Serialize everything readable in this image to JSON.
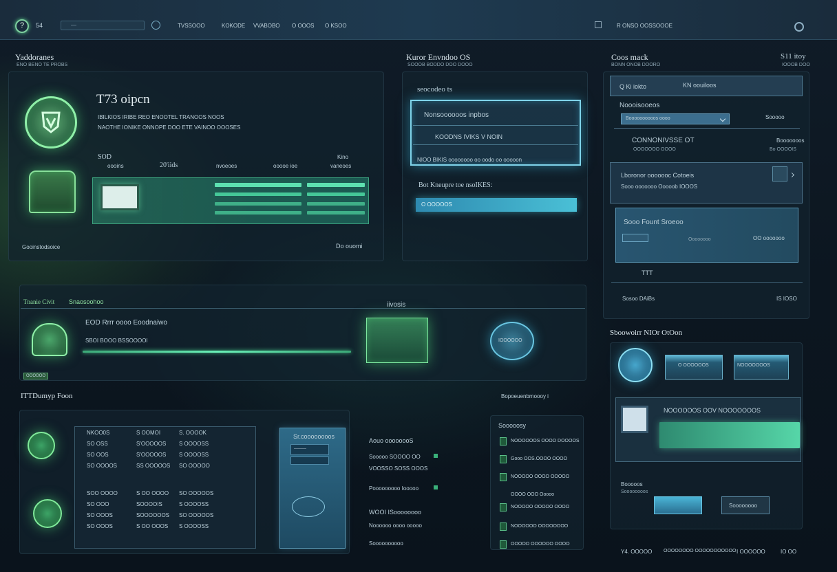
{
  "topbar": {
    "help_glyph": "?",
    "num": "54",
    "search_text": "—",
    "nav1": "TVSSOOO",
    "nav2": "KOKODE",
    "nav3": "VVABOBO",
    "nav4": "O OOOS",
    "nav5": "O KSOO",
    "right_label": "R ONSO OOSSOOOE"
  },
  "panel_a": {
    "title": "Yaddoranes",
    "subtitle": "ENO BENO TE PROBS",
    "big": "T73 oipcn",
    "line1": "IBILKIOS IRIBE REO ENOOTEL TRANOOS NOOS",
    "line2": "NAOTHE IONIKE ONNOPE DOO ETE VAINOO OOOSES",
    "stat1_label": "SOD",
    "stat1": "oooins",
    "stat2": "20'iids",
    "stat3": "nvoeoes",
    "stat4": "ooooe ioe",
    "stat5a": "Kino",
    "stat5b": "vaneoes",
    "footer_left": "Gooinstodsoice",
    "footer_right": "Do ouomi"
  },
  "panel_b": {
    "title": "Kuror Envndoo  OS",
    "subtitle": "SOOOB BODDO DOO DOOO",
    "heading": "seocodeo  ts",
    "box_title": "Nonsoooooos inpbos",
    "box_item": "KOODNS  IVIKS V NOIN",
    "box_footer": "NIOO BIKIS  oooooooo oo oodo oo ooooon",
    "label2": "Bot Kneupre toe nsoIKES:",
    "bar_text": "O OOOOOS"
  },
  "panel_c": {
    "title": "Coos mack",
    "subtitle": "BONN ONOB DOORO",
    "right": "S11 itoy",
    "right_sub": "IOOOB DOO",
    "row1a": "Q Ki iokto",
    "row1b": "KN oouiloos",
    "heading": "Noooisooeos",
    "select_text": "Boooooooooos oooo",
    "select_right": "Sooooo",
    "cont": "CONNONIVSSE  OT",
    "cont_right": "Booooooos",
    "cont_sub": "OOOOOOO OOOO",
    "cont_sub_right": "Bo OOOOIS",
    "sec2": "Lboronor ooooooc Cotoeis",
    "sec2_sub": "Sooo ooooooo Ooooob IOOOS",
    "inner": "Sooo  Fount  Sroeoo",
    "inner_mid": "Oooooooo",
    "inner_right": "OO ooooooo",
    "inner_icon": "TTT",
    "footer_left": "Sosoo DAiBs",
    "footer_right": "IS IOSO"
  },
  "panel_d": {
    "title_a": "Tnanie Civit",
    "title_b": "Snaosoohoo",
    "center": "iivosis",
    "row_title": "EOD Rrrr oooo Eoodnaiwo",
    "row_sub": "SBOI  BOOO  BSSOOOOI",
    "badge": "OOOOOO",
    "orb_label": "IOOOOOO"
  },
  "panel_e": {
    "title": "Sboowoirr  NIOr  OtOon"
  },
  "table": {
    "title": "ITTDumyp Foon",
    "right_label": "Bopoeuenbmoooy i",
    "rows": [
      [
        "NKOO0S",
        "S OOMOI",
        "S. OOOOK"
      ],
      [
        "SO OSS",
        "S'OOOOOS",
        "S  OOOOSS"
      ],
      [
        "SO OOS",
        "S'OOOOOS",
        "S  OOOOSS"
      ],
      [
        "SO OOOOS",
        "SS OOOOOS",
        "SO OOOOO"
      ],
      [
        "SOO OOOO",
        "S OO OOOO",
        "SO OOOOOS"
      ],
      [
        "SO OOO",
        "SOOOOIS",
        "S  OOOOSS"
      ],
      [
        "SO OOOS",
        "SOOOOOOS",
        "SO OOOOOS"
      ],
      [
        "SO OOOS",
        "S OO OOOS",
        "S  OOOOSS"
      ]
    ]
  },
  "panel_f": {
    "title": "Sr.coooooooos",
    "field": "———",
    "side_a": "Aouo oooooooS",
    "side_b": "Sooooo SOOOO OO",
    "side_c": "VOOSSO SOSS OOOS",
    "side_d": "Pooooooooo Iooooo",
    "side_e": "WOOI  ISoooooooo",
    "side_f": "Noooooo oooo ooooo",
    "side_g": "Soooooooooo"
  },
  "panel_g": {
    "title": "Sooooosy",
    "items": [
      "NOOOOOOS OOOO DOOOOS",
      "Gooo OOS.OOOO OOOO",
      "NOOOOO OOOO OOOOO",
      "OOOO OOO Ooooo",
      "NOOOOO OOOOO OOOO",
      "NOOOOOO OOOOOOOO",
      "OOOOO OOOOOO OOOO"
    ]
  },
  "panel_h": {
    "bar1": "O OOOOOOS",
    "bar2": "NOOOOOOOS",
    "line": "NOOOOOOS OOV NOOOOOOOS",
    "sub": "Booooos",
    "sub2": "Soooooooos",
    "btn": "Soooooooo",
    "footer1": "Y4. OOOOO",
    "footer2": "OOOOOOOO OOOOOOOOOOO",
    "footer3": "I OOOOOO",
    "footer4": "IO OO"
  }
}
